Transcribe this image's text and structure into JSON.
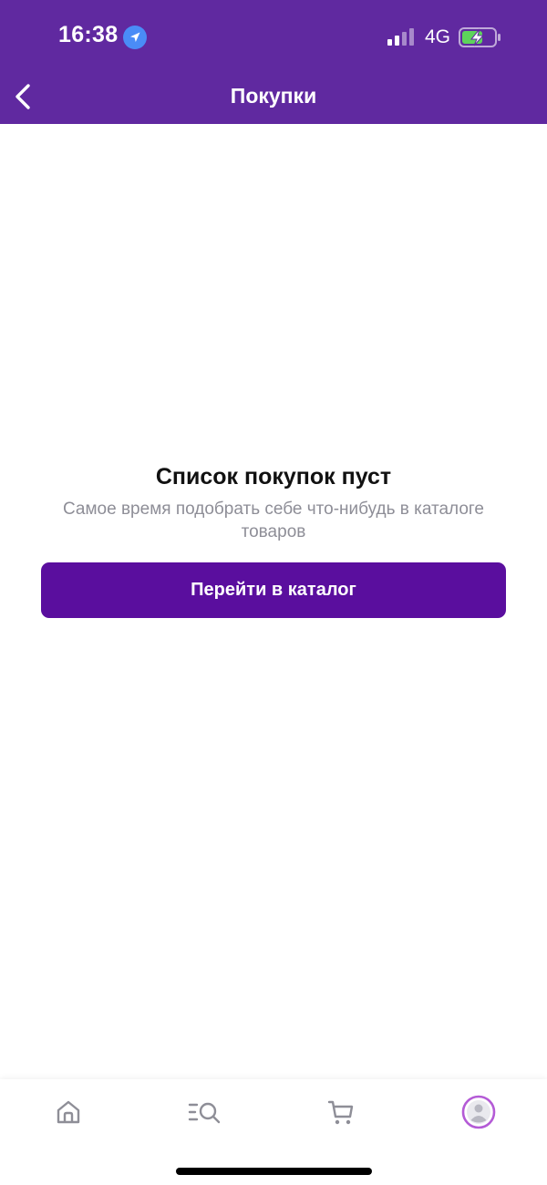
{
  "status_bar": {
    "time": "16:38",
    "network": "4G",
    "icons": [
      "location-icon",
      "signal-icon",
      "battery-charging-icon"
    ]
  },
  "nav": {
    "title": "Покупки",
    "back_icon": "chevron-left-icon"
  },
  "empty_state": {
    "title": "Список покупок пуст",
    "subtitle": "Самое время подобрать себе что-нибудь в каталоге товаров",
    "button_label": "Перейти в каталог"
  },
  "tab_bar": {
    "tabs": [
      {
        "icon": "home-icon",
        "active": false
      },
      {
        "icon": "catalog-search-icon",
        "active": false
      },
      {
        "icon": "cart-icon",
        "active": false
      },
      {
        "icon": "profile-icon",
        "active": true
      }
    ]
  },
  "colors": {
    "header": "#6029a0",
    "button": "#5a0e9e",
    "profile_accent": "#b45bd6",
    "inactive_icon": "#8e8e97",
    "location_badge": "#4a8cf7",
    "battery_fill": "#5dd35b"
  }
}
